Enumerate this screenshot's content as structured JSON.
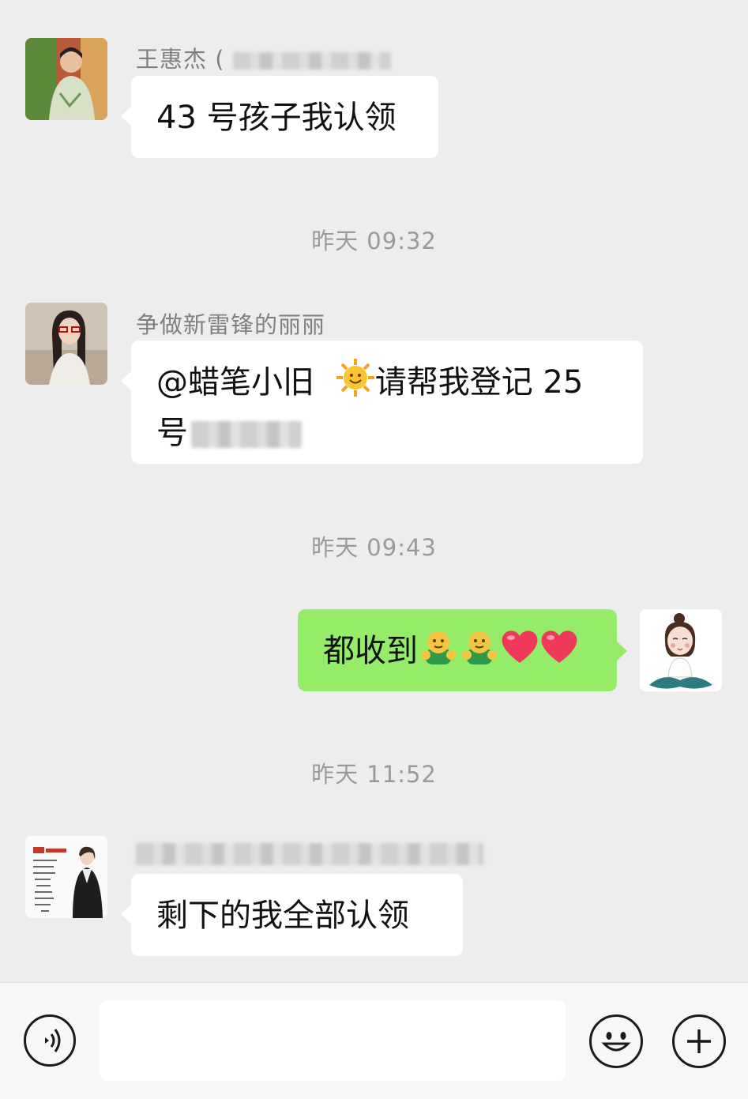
{
  "messages": [
    {
      "sender": "王惠杰 (",
      "text": "43 号孩子我认领"
    },
    {
      "sender": "争做新雷锋的丽丽",
      "text_line1": "@蜡笔小旧 ",
      "text_line1b": "请帮我登记 25",
      "text_line2": "号"
    },
    {
      "text": "都收到"
    },
    {
      "text": "剩下的我全部认领"
    }
  ],
  "timestamps": [
    "昨天 09:32",
    "昨天 09:43",
    "昨天 11:52"
  ],
  "input": {
    "placeholder": ""
  },
  "colors": {
    "background": "#ededed",
    "bubble_self": "#95ec69",
    "bubble_other": "#ffffff"
  }
}
